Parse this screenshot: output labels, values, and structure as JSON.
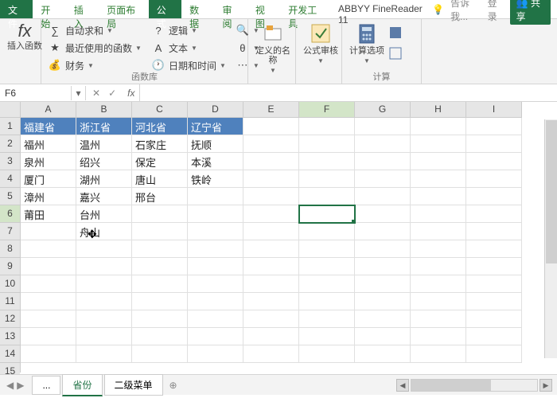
{
  "tabs": {
    "file": "文件",
    "home": "开始",
    "insert": "插入",
    "layout": "页面布局",
    "formula": "公式",
    "data": "数据",
    "review": "审阅",
    "view": "视图",
    "dev": "开发工具",
    "abbyy": "ABBYY FineReader 11"
  },
  "topright": {
    "tell": "告诉我...",
    "login": "登录",
    "share": "共享"
  },
  "ribbon": {
    "insertFn": "插入函数",
    "autosum": "自动求和",
    "recent": "最近使用的函数",
    "financial": "财务",
    "logical": "逻辑",
    "text": "文本",
    "datetime": "日期和时间",
    "lookup": "",
    "math": "",
    "more": "",
    "defname": "定义的名称",
    "audit": "公式审核",
    "calc": "计算选项",
    "g1": "函数库",
    "g2": "",
    "g3": "计算"
  },
  "namebox": "F6",
  "colHeaders": [
    "A",
    "B",
    "C",
    "D",
    "E",
    "F",
    "G",
    "H",
    "I"
  ],
  "rowHeaders": [
    "1",
    "2",
    "3",
    "4",
    "5",
    "6",
    "7",
    "8",
    "9",
    "10",
    "11",
    "12",
    "13",
    "14",
    "15"
  ],
  "grid": [
    [
      "福建省",
      "浙江省",
      "河北省",
      "辽宁省",
      "",
      "",
      "",
      "",
      ""
    ],
    [
      "福州",
      "温州",
      "石家庄",
      "抚顺",
      "",
      "",
      "",
      "",
      ""
    ],
    [
      "泉州",
      "绍兴",
      "保定",
      "本溪",
      "",
      "",
      "",
      "",
      ""
    ],
    [
      "厦门",
      "湖州",
      "唐山",
      "铁岭",
      "",
      "",
      "",
      "",
      ""
    ],
    [
      "漳州",
      "嘉兴",
      "邢台",
      "",
      "",
      "",
      "",
      "",
      ""
    ],
    [
      "莆田",
      "台州",
      "",
      "",
      "",
      "",
      "",
      "",
      ""
    ],
    [
      "",
      "舟山",
      "",
      "",
      "",
      "",
      "",
      "",
      ""
    ],
    [
      "",
      "",
      "",
      "",
      "",
      "",
      "",
      "",
      ""
    ],
    [
      "",
      "",
      "",
      "",
      "",
      "",
      "",
      "",
      ""
    ],
    [
      "",
      "",
      "",
      "",
      "",
      "",
      "",
      "",
      ""
    ],
    [
      "",
      "",
      "",
      "",
      "",
      "",
      "",
      "",
      ""
    ],
    [
      "",
      "",
      "",
      "",
      "",
      "",
      "",
      "",
      ""
    ],
    [
      "",
      "",
      "",
      "",
      "",
      "",
      "",
      "",
      ""
    ],
    [
      "",
      "",
      "",
      "",
      "",
      "",
      "",
      "",
      ""
    ]
  ],
  "sheetTabs": {
    "dots": "...",
    "s1": "省份",
    "s2": "二级菜单"
  },
  "activeCell": {
    "row": 5,
    "col": 5
  }
}
